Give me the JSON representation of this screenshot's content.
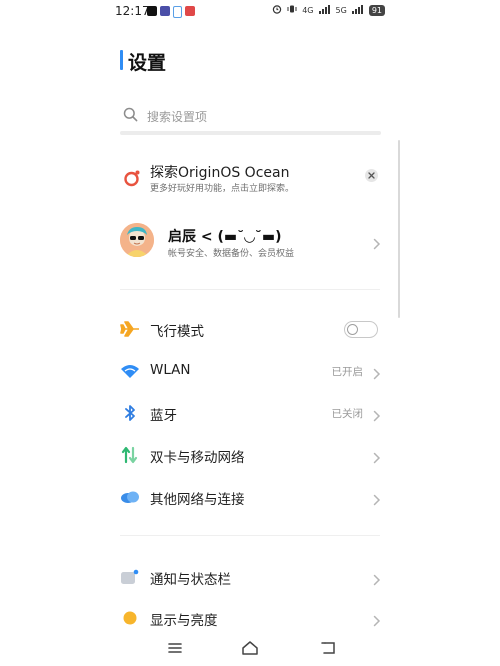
{
  "status_bar": {
    "time": "12:17",
    "net_labels": [
      "4G",
      "5G"
    ],
    "battery": "91"
  },
  "page": {
    "title": "设置"
  },
  "search": {
    "placeholder": "搜索设置项"
  },
  "promo": {
    "title": "探索OriginOS Ocean",
    "subtitle": "更多好玩好用功能，点击立即探索。"
  },
  "account": {
    "name": "启辰 < (▬˘◡˘▬)",
    "subtitle": "帐号安全、数据备份、会员权益"
  },
  "network": [
    {
      "label": "飞行模式",
      "icon": "airplane-icon",
      "toggle": false
    },
    {
      "label": "WLAN",
      "icon": "wifi-icon",
      "value": "已开启"
    },
    {
      "label": "蓝牙",
      "icon": "bluetooth-icon",
      "value": "已关闭"
    },
    {
      "label": "双卡与移动网络",
      "icon": "dual-sim-icon"
    },
    {
      "label": "其他网络与连接",
      "icon": "cloud-icon"
    }
  ],
  "device": [
    {
      "label": "通知与状态栏",
      "icon": "notification-icon"
    },
    {
      "label": "显示与亮度",
      "icon": "brightness-icon"
    }
  ],
  "colors": {
    "accent": "#2f8df5",
    "airplane": "#f5a623",
    "wifi": "#2f8df5",
    "bluetooth": "#2f7de1",
    "sim": "#2eb872",
    "brightness": "#f7b52c",
    "promo": "#e8533f"
  }
}
